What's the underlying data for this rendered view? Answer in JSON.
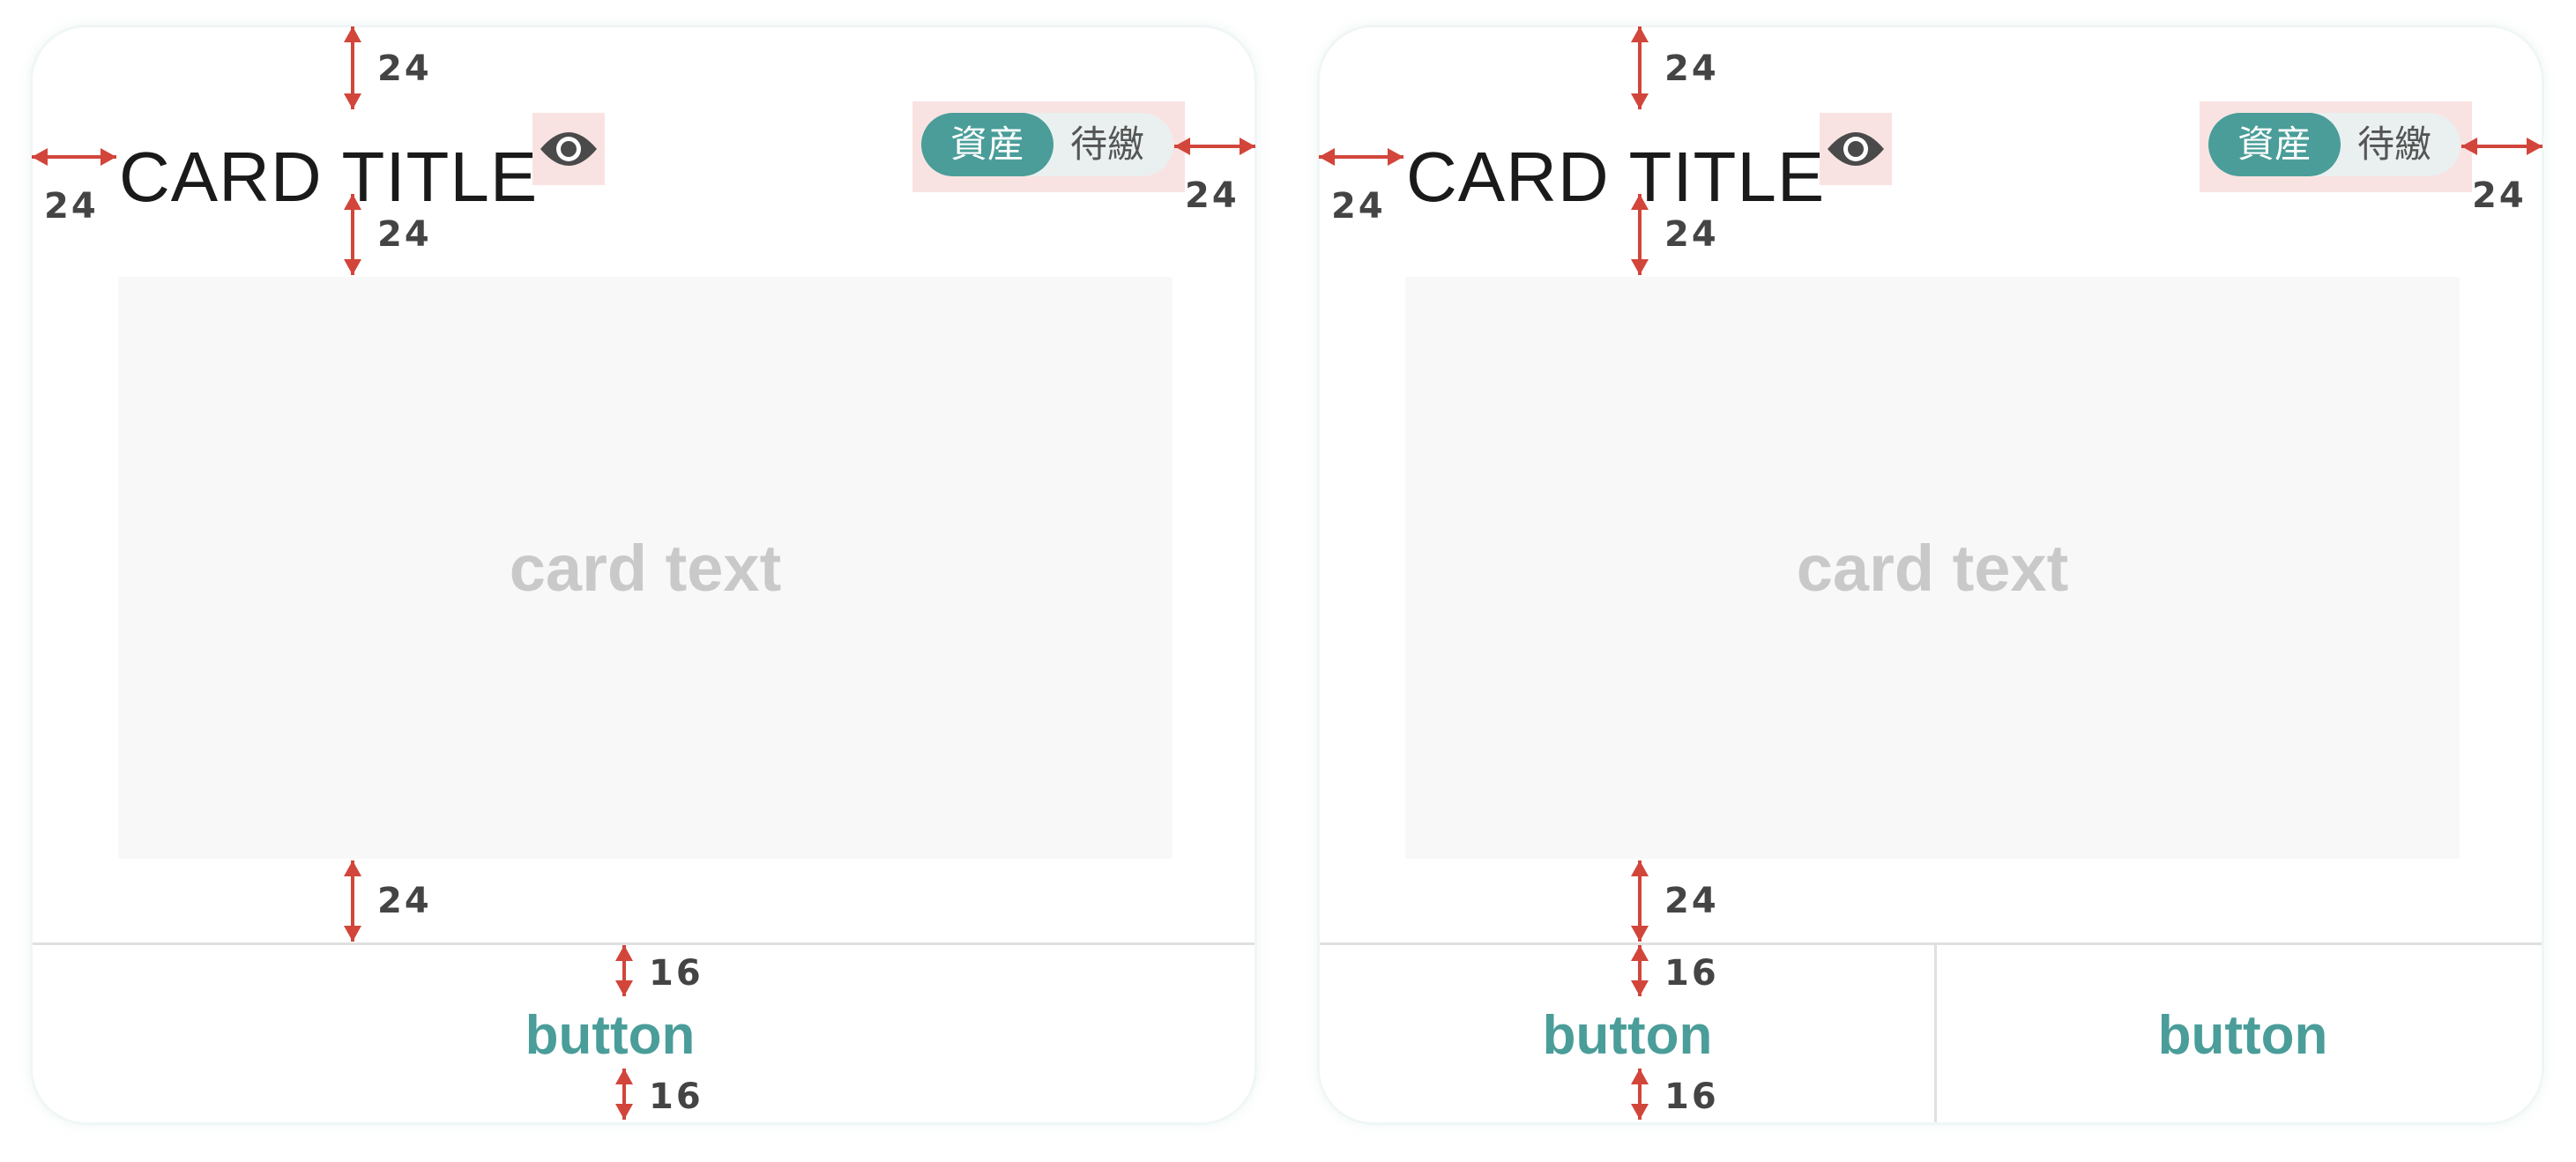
{
  "cards": [
    {
      "title": "CARD TITLE",
      "toggle": {
        "active": "資産",
        "inactive": "待繳"
      },
      "content_text": "card text",
      "buttons": [
        "button"
      ],
      "spacing": {
        "top": "24",
        "left": "24",
        "right": "24",
        "title_gap": "24",
        "content_gap": "24",
        "button_top": "16",
        "button_bottom": "16"
      }
    },
    {
      "title": "CARD TITLE",
      "toggle": {
        "active": "資産",
        "inactive": "待繳"
      },
      "content_text": "card text",
      "buttons": [
        "button",
        "button"
      ],
      "spacing": {
        "top": "24",
        "left": "24",
        "right": "24",
        "title_gap": "24",
        "content_gap": "24",
        "button_top": "16",
        "button_bottom": "16"
      }
    }
  ],
  "colors": {
    "accent": "#4a9d99",
    "highlight": "#f9e3e2",
    "annotation": "#d2453b",
    "placeholder": "#f8f8f8"
  },
  "icons": [
    "eye-icon",
    "double-arrow-icon"
  ]
}
